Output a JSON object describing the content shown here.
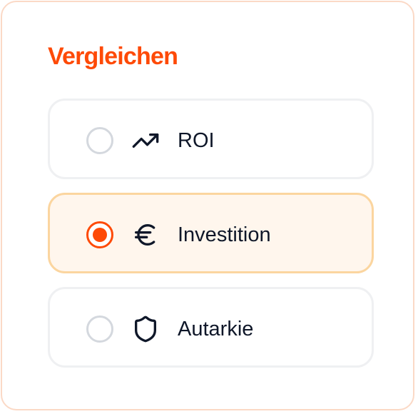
{
  "title": "Vergleichen",
  "options": [
    {
      "label": "ROI",
      "icon": "trending-up-icon",
      "selected": false
    },
    {
      "label": "Investition",
      "icon": "euro-icon",
      "selected": true
    },
    {
      "label": "Autarkie",
      "icon": "shield-icon",
      "selected": false
    }
  ],
  "colors": {
    "accent": "#fe4a07",
    "selected_border": "#fbd59f",
    "selected_bg": "#fff6ed",
    "card_border": "#fbd9c6",
    "text": "#0f1729"
  }
}
